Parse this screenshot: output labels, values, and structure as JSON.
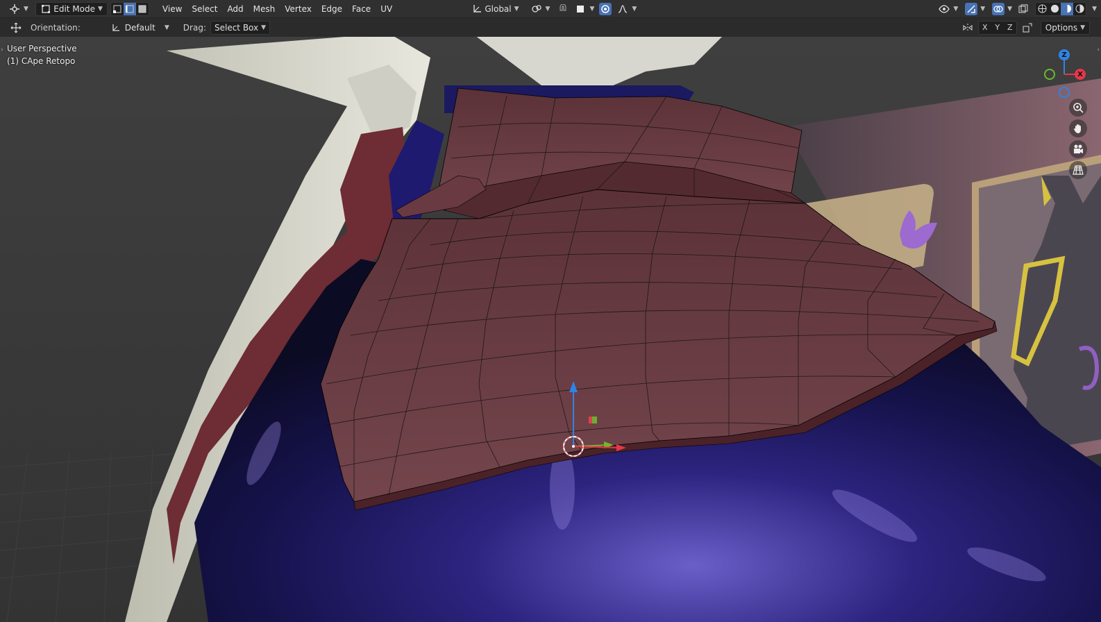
{
  "header": {
    "editor_type_icon": "editor-type-icon",
    "mode": "Edit Mode",
    "select_modes": [
      "vertex",
      "edge",
      "face"
    ],
    "active_select_mode": "edge",
    "menu": [
      "View",
      "Select",
      "Add",
      "Mesh",
      "Vertex",
      "Edge",
      "Face",
      "UV"
    ],
    "transform_orientation": "Global"
  },
  "toolbar": {
    "orientation_label": "Orientation:",
    "orientation_value": "Default",
    "drag_label": "Drag:",
    "drag_value": "Select Box",
    "axes": [
      "X",
      "Y",
      "Z"
    ],
    "options_label": "Options"
  },
  "viewport": {
    "view_name": "User Perspective",
    "object_name": "(1) CApe Retopo",
    "gizmo_axes": {
      "x": "X",
      "z": "Z"
    },
    "colors": {
      "x_axis": "#e5374a",
      "y_axis": "#6fb82d",
      "z_axis": "#2f83e6",
      "mesh": "#6b3a42",
      "active_button": "#4772b3"
    }
  }
}
